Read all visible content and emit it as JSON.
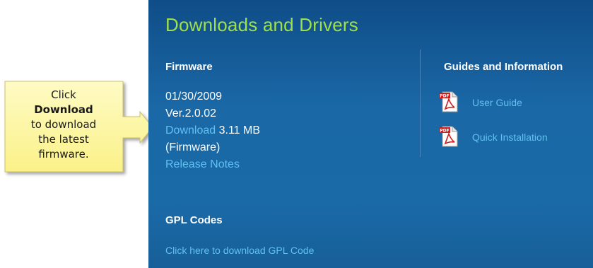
{
  "callout": {
    "line1": "Click",
    "line2": "Download",
    "line3": "to download",
    "line4": "the latest",
    "line5": "firmware."
  },
  "panel": {
    "title": "Downloads and Drivers",
    "firmware": {
      "heading": "Firmware",
      "date": "01/30/2009",
      "version": "Ver.2.0.02",
      "download_label": "Download",
      "file_size": "3.11 MB",
      "type": "(Firmware)",
      "release_notes_label": "Release Notes"
    },
    "guides": {
      "heading": "Guides and Information",
      "items": [
        {
          "label": "User Guide",
          "icon": "pdf-icon"
        },
        {
          "label": "Quick Installation",
          "icon": "pdf-icon"
        }
      ]
    },
    "gpl": {
      "heading": "GPL Codes",
      "link_label": "Click here to download GPL Code"
    }
  },
  "colors": {
    "panel_bg": "#1a68a6",
    "title_green": "#9ee04b",
    "link_blue": "#61c0f0",
    "callout_yellow": "#fdf7a6",
    "pdf_red": "#d01e1e"
  }
}
